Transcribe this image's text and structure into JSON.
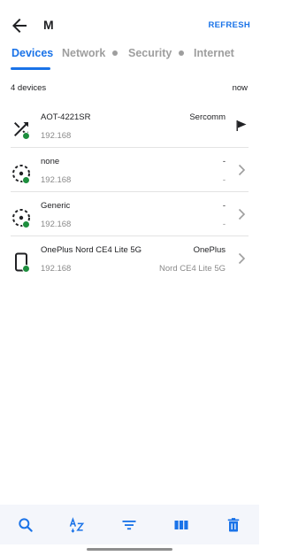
{
  "appbar": {
    "title": "M",
    "refresh_label": "REFRESH"
  },
  "tabs": [
    {
      "label": "Devices",
      "active": true
    },
    {
      "label": "Network",
      "active": false
    },
    {
      "label": "Security",
      "active": false
    },
    {
      "label": "Internet",
      "active": false
    }
  ],
  "summary": {
    "count_label": "4 devices",
    "time_label": "now"
  },
  "devices": [
    {
      "icon": "shuffle-icon",
      "name": "AOT-4221SR",
      "ip": "192.168",
      "vendor": "Sercomm",
      "vendor_detail": "",
      "trailing": "flag-icon"
    },
    {
      "icon": "unknown-device-icon",
      "name": "none",
      "ip": "192.168",
      "vendor": "-",
      "vendor_detail": "-",
      "trailing": "chevron-right-icon"
    },
    {
      "icon": "unknown-device-icon",
      "name": "Generic",
      "ip": "192.168",
      "vendor": "-",
      "vendor_detail": "-",
      "trailing": "chevron-right-icon"
    },
    {
      "icon": "phone-icon",
      "name": "OnePlus Nord CE4 Lite 5G",
      "ip": "192.168",
      "vendor": "OnePlus",
      "vendor_detail": "Nord CE4 Lite 5G",
      "trailing": "chevron-right-icon"
    }
  ],
  "bottombar": {
    "buttons": [
      {
        "icon": "search-icon"
      },
      {
        "icon": "sort-az-icon"
      },
      {
        "icon": "filter-icon"
      },
      {
        "icon": "columns-icon"
      },
      {
        "icon": "delete-icon"
      }
    ]
  },
  "colors": {
    "accent": "#1a73e8",
    "status_online": "#1e8e3e",
    "muted": "#9e9e9e"
  }
}
